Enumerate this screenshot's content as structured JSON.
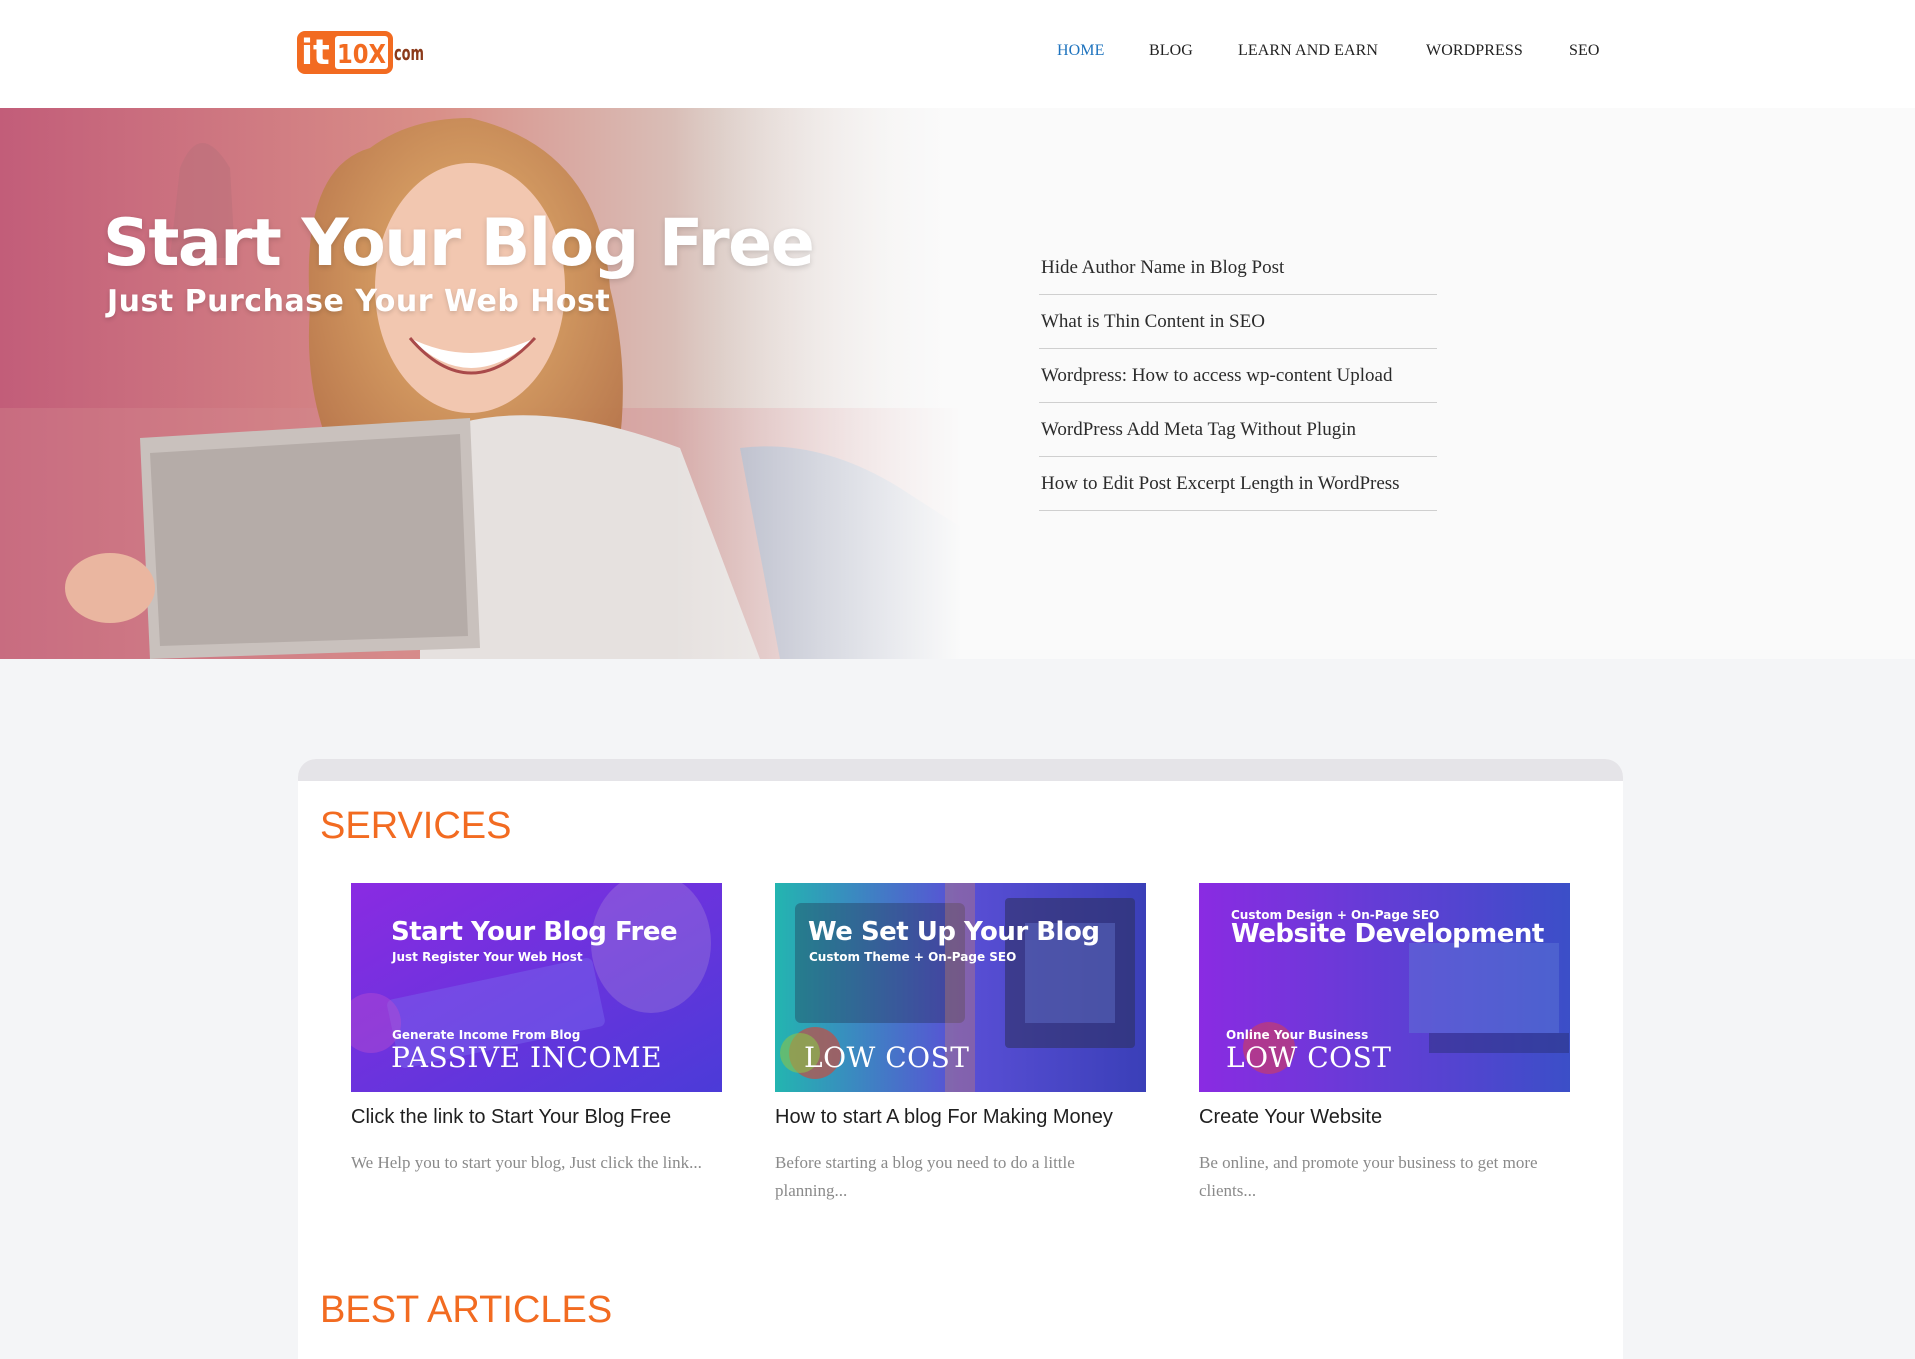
{
  "header": {
    "logo": {
      "mark": "it",
      "number": "10X",
      "suffix": "com"
    },
    "nav": [
      {
        "label": "HOME",
        "active": true
      },
      {
        "label": "BLOG",
        "active": false
      },
      {
        "label": "LEARN AND EARN",
        "active": false
      },
      {
        "label": "WORDPRESS",
        "active": false
      },
      {
        "label": "SEO",
        "active": false
      }
    ]
  },
  "hero": {
    "banner_title": "Start Your Blog Free",
    "banner_subtitle": "Just Purchase Your Web Host",
    "recent_posts": [
      "Hide Author Name in Blog Post",
      "What is Thin Content in SEO",
      "Wordpress: How to access wp-content Upload",
      "WordPress Add Meta Tag Without Plugin",
      "How to Edit Post Excerpt Length in WordPress"
    ]
  },
  "services": {
    "title": "SERVICES",
    "items": [
      {
        "image_title": "Start Your Blog Free",
        "image_subtitle": "Just Register Your Web Host",
        "image_caption_small": "Generate Income From Blog",
        "image_caption_big": "PASSIVE INCOME",
        "name": "Click the link to Start Your Blog Free",
        "description": "We Help you to start your blog, Just click the link..."
      },
      {
        "image_title": "We Set Up Your Blog",
        "image_subtitle": "Custom Theme + On-Page SEO",
        "image_caption_big": "LOW COST",
        "name": "How to start A blog For Making Money",
        "description": "Before starting a blog you need to do a little planning..."
      },
      {
        "image_title": "Website Development",
        "image_subtitle": "Custom Design + On-Page SEO",
        "image_caption_small": "Online Your Business",
        "image_caption_big": "LOW COST",
        "name": "Create Your Website",
        "description": "Be online, and promote your business to get more clients..."
      }
    ]
  },
  "articles": {
    "title": "BEST ARTICLES"
  },
  "colors": {
    "accent_orange": "#f26b21",
    "nav_active": "#1e73be",
    "logo_brown": "#8b3a1a"
  }
}
